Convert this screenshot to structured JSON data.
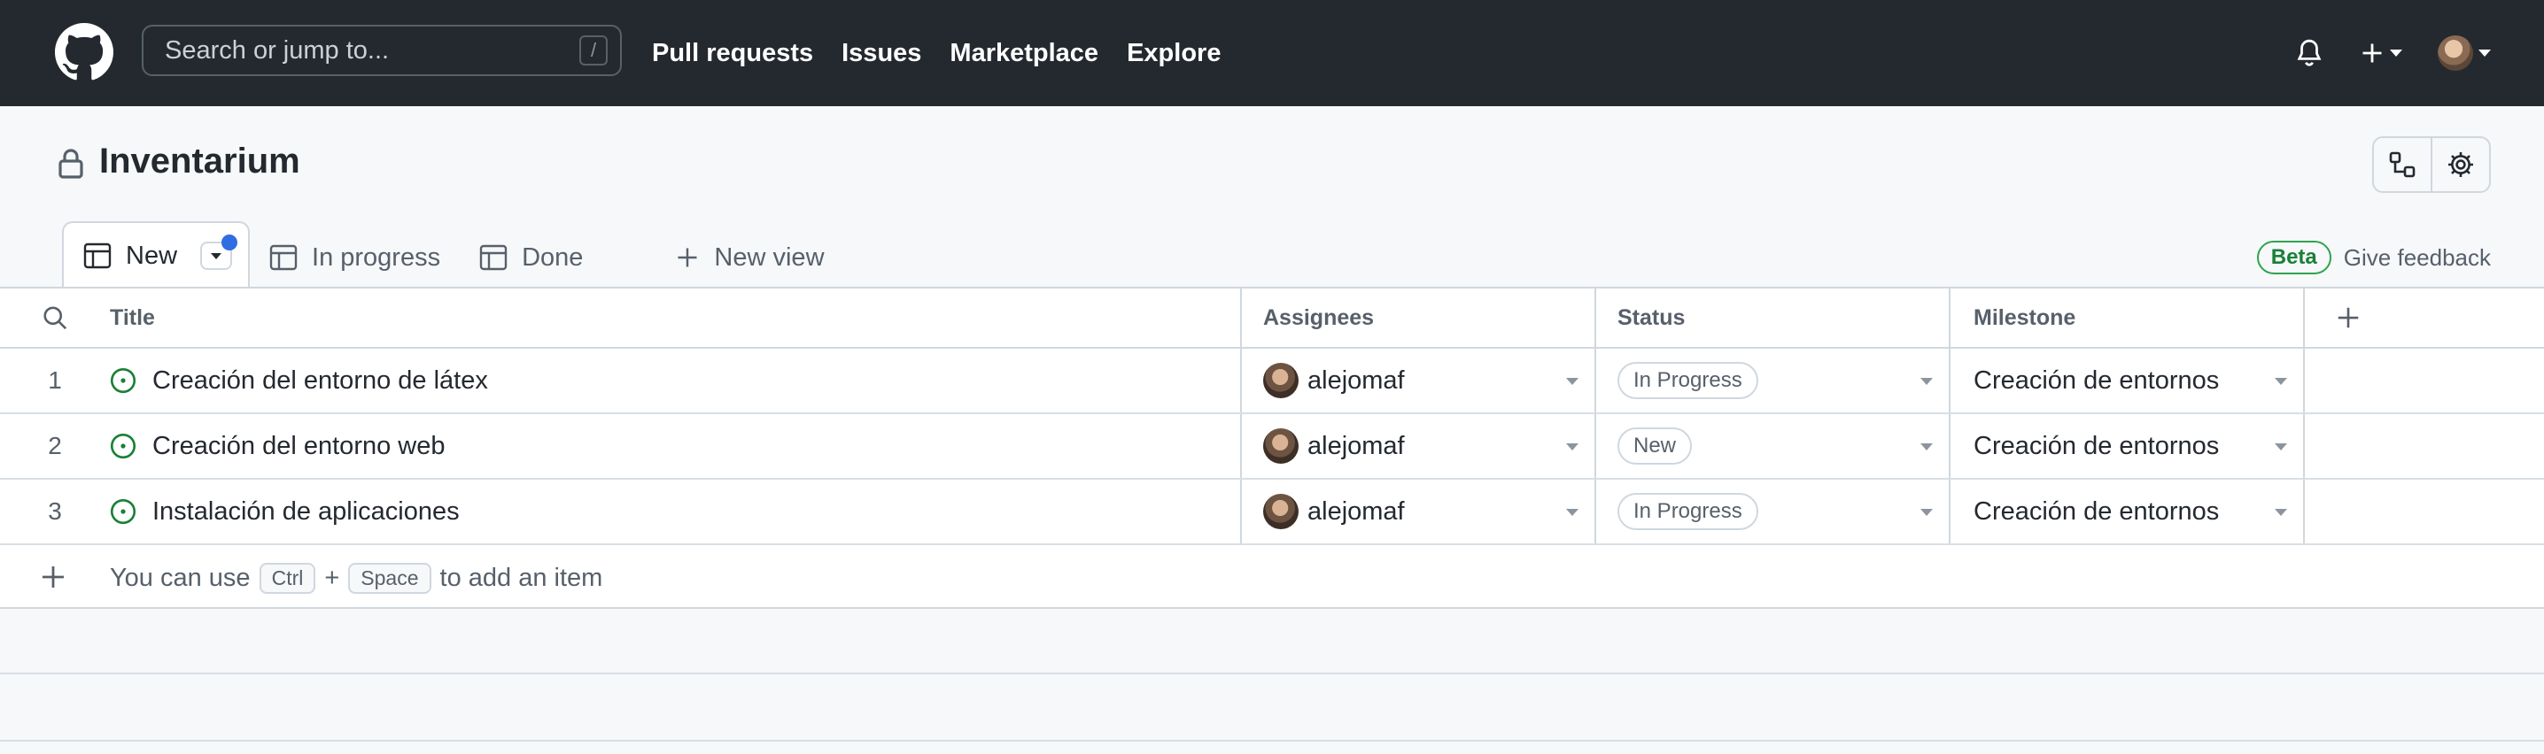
{
  "nav": {
    "search_placeholder": "Search or jump to...",
    "search_shortcut": "/",
    "links": [
      "Pull requests",
      "Issues",
      "Marketplace",
      "Explore"
    ]
  },
  "project": {
    "title": "Inventarium"
  },
  "views": {
    "tabs": [
      {
        "label": "New",
        "active": true,
        "has_unsaved_dot": true
      },
      {
        "label": "In progress",
        "active": false
      },
      {
        "label": "Done",
        "active": false
      }
    ],
    "new_view_label": "New view",
    "beta_label": "Beta",
    "feedback_label": "Give feedback"
  },
  "table": {
    "columns": [
      "Title",
      "Assignees",
      "Status",
      "Milestone"
    ],
    "rows": [
      {
        "index": "1",
        "title": "Creación del entorno de látex",
        "assignee": "alejomaf",
        "status": "In Progress",
        "milestone": "Creación de entornos"
      },
      {
        "index": "2",
        "title": "Creación del entorno web",
        "assignee": "alejomaf",
        "status": "New",
        "milestone": "Creación de entornos"
      },
      {
        "index": "3",
        "title": "Instalación de aplicaciones",
        "assignee": "alejomaf",
        "status": "In Progress",
        "milestone": "Creación de entornos"
      }
    ],
    "add_item": {
      "prefix": "You can use",
      "key1": "Ctrl",
      "plus": "+",
      "key2": "Space",
      "suffix": "to add an item"
    }
  },
  "colors": {
    "nav_bg": "#24292f",
    "open_icon": "#1a7f37",
    "beta_green": "#2da44e",
    "unsaved_dot": "#2f6de1"
  }
}
